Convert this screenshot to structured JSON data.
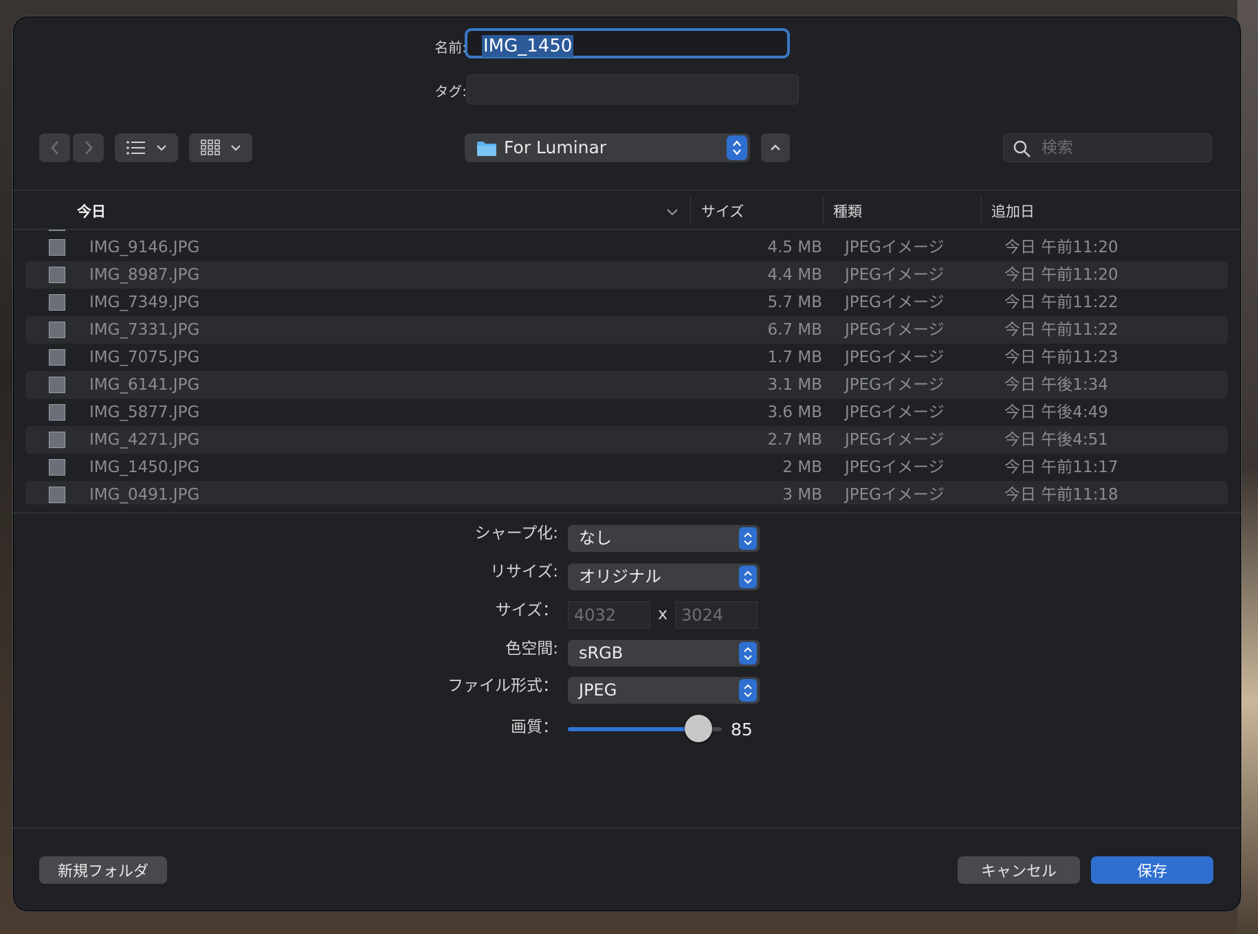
{
  "dialog": {
    "name_label": "名前:",
    "name_value": "IMG_1450",
    "tag_label": "タグ:",
    "tag_value": ""
  },
  "toolbar": {
    "back_icon": "chevron-left-icon",
    "forward_icon": "chevron-right-icon",
    "list_view_icon": "list-icon",
    "grid_view_icon": "grid-icon",
    "folder_name": "For Luminar",
    "search_placeholder": "検索"
  },
  "columns": {
    "name": "今日",
    "size": "サイズ",
    "kind": "種類",
    "date": "追加日"
  },
  "files": [
    {
      "name": "IMG_9146.JPG",
      "size": "4.5 MB",
      "kind": "JPEGイメージ",
      "date": "今日 午前11:20"
    },
    {
      "name": "IMG_8987.JPG",
      "size": "4.4 MB",
      "kind": "JPEGイメージ",
      "date": "今日 午前11:20"
    },
    {
      "name": "IMG_7349.JPG",
      "size": "5.7 MB",
      "kind": "JPEGイメージ",
      "date": "今日 午前11:22"
    },
    {
      "name": "IMG_7331.JPG",
      "size": "6.7 MB",
      "kind": "JPEGイメージ",
      "date": "今日 午前11:22"
    },
    {
      "name": "IMG_7075.JPG",
      "size": "1.7 MB",
      "kind": "JPEGイメージ",
      "date": "今日 午前11:23"
    },
    {
      "name": "IMG_6141.JPG",
      "size": "3.1 MB",
      "kind": "JPEGイメージ",
      "date": "今日 午後1:34"
    },
    {
      "name": "IMG_5877.JPG",
      "size": "3.6 MB",
      "kind": "JPEGイメージ",
      "date": "今日 午後4:49"
    },
    {
      "name": "IMG_4271.JPG",
      "size": "2.7 MB",
      "kind": "JPEGイメージ",
      "date": "今日 午後4:51"
    },
    {
      "name": "IMG_1450.JPG",
      "size": "2 MB",
      "kind": "JPEGイメージ",
      "date": "今日 午前11:17"
    },
    {
      "name": "IMG_0491.JPG",
      "size": "3 MB",
      "kind": "JPEGイメージ",
      "date": "今日 午前11:18"
    }
  ],
  "options": {
    "sharpen_label": "シャープ化:",
    "sharpen_value": "なし",
    "resize_label": "リサイズ:",
    "resize_value": "オリジナル",
    "size_label": "サイズ：",
    "width": "4032",
    "x": "x",
    "height": "3024",
    "colorspace_label": "色空間:",
    "colorspace_value": "sRGB",
    "format_label": "ファイル形式：",
    "format_value": "JPEG",
    "quality_label": "画質：",
    "quality_value": "85",
    "quality_fraction": 0.85
  },
  "buttons": {
    "new_folder": "新規フォルダ",
    "cancel": "キャンセル",
    "save": "保存"
  },
  "colors": {
    "accent": "#2f6fd0",
    "dialog_bg": "#1f2125"
  }
}
